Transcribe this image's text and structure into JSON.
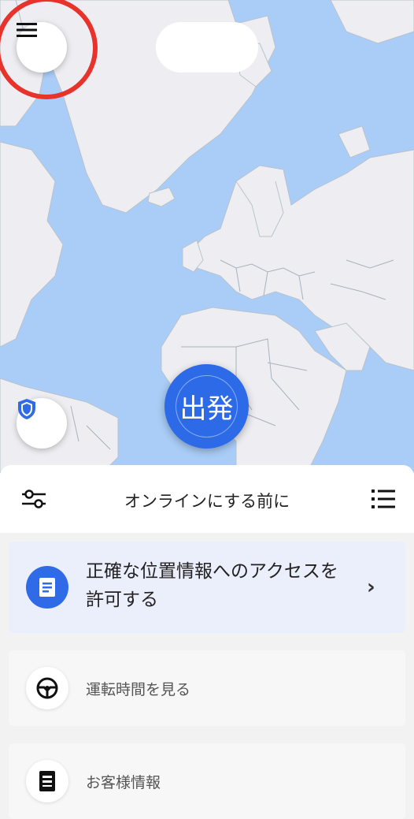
{
  "header": {
    "title": "オンラインにする前に"
  },
  "go_button": {
    "label": "出発"
  },
  "cards": [
    {
      "title": "正確な位置情報へのアクセスを許可する",
      "icon": "document-icon",
      "color": "#2f6be6"
    },
    {
      "title": "運転時間を見る",
      "icon": "steering-wheel-icon"
    },
    {
      "title": "お客様情報",
      "icon": "notepad-icon"
    }
  ],
  "colors": {
    "map_water": "#a9cdf7",
    "map_land": "#eeeef2",
    "accent": "#2c6ae8",
    "highlight": "#e8322c"
  }
}
